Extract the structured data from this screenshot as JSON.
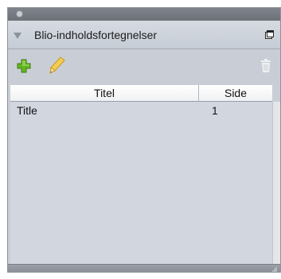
{
  "panel": {
    "title": "Blio-indholdsfortegnelser",
    "icons": {
      "collapse": "disclosure-triangle-icon",
      "menu": "panel-menu-icon",
      "add": "plus-icon",
      "edit": "pencil-icon",
      "delete": "trash-icon",
      "resize": "resize-grip-icon"
    },
    "colors": {
      "panel_bg": "#c9ced6",
      "add_green": "#5fb81f",
      "pencil_yellow": "#f0c84a"
    }
  },
  "table": {
    "columns": [
      "Titel",
      "Side"
    ],
    "rows": [
      {
        "title": "Title",
        "page": "1"
      }
    ]
  }
}
